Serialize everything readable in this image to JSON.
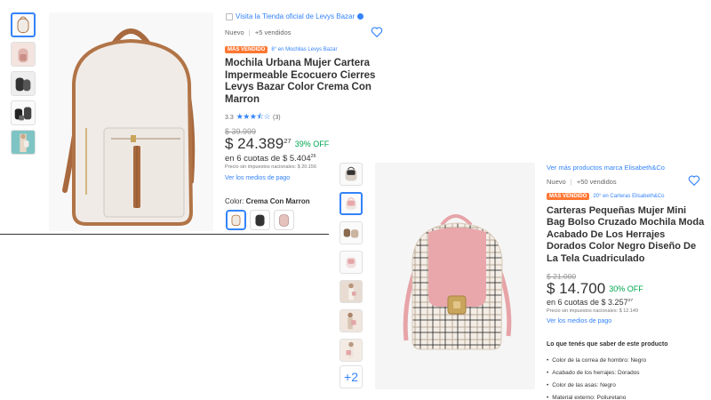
{
  "colors": {
    "accent": "#3483fa",
    "green": "#00a650",
    "badge": "#ff7733"
  },
  "product1": {
    "store_link": "Visita la Tienda oficial de Levys Bazar",
    "condition": "Nuevo",
    "sold": "+5 vendidos",
    "badge": "MÁS VENDIDO",
    "badge_rank": "8° en Mochilas Levys Bazar",
    "title": "Mochila Urbana Mujer Cartera Impermeable Ecocuero Cierres Levys Bazar Color Crema Con Marron",
    "rating": "3.3",
    "stars": 3.3,
    "reviews": "(3)",
    "old_price": "$ 39.999",
    "price": "$ 24.389",
    "price_cents": "27",
    "discount": "39% OFF",
    "installments": "en 6 cuotas de $ 5.404",
    "installments_cents": "26",
    "tax_note": "Precio sin impuestos nacionales: $ 20.156",
    "payment_link": "Ver los medios de pago",
    "color_label": "Color:",
    "color_value": "Crema Con Marron",
    "thumb_icons": [
      "backpack-cream-icon",
      "backpack-pink-icon",
      "backpack-black-icon",
      "backpack-black-set-icon",
      "backpack-model-icon"
    ],
    "swatch_icons": [
      "swatch-cream-icon",
      "swatch-black-icon",
      "swatch-pink-icon"
    ]
  },
  "product2": {
    "brand_link": "Ver más productos marca Elisabeth&Co",
    "condition": "Nuevo",
    "sold": "+50 vendidos",
    "badge": "MÁS VENDIDO",
    "badge_rank": "20° en Carteras Elisabeth&Co",
    "title": "Carteras Pequeñas Mujer Mini Bag Bolso Cruzado Mochila Moda Acabado De Los Herrajes Dorados Color Negro Diseño De La Tela Cuadriculado",
    "old_price": "$ 21.000",
    "price": "$ 14.700",
    "discount": "30% OFF",
    "installments": "en 6 cuotas de $ 3.257",
    "installments_cents": "27",
    "tax_note": "Precio sin impuestos nacionales: $ 12.149",
    "payment_link": "Ver los medios de pago",
    "more_thumbs": "+2",
    "know_title": "Lo que tenés que saber de este producto",
    "specs": [
      "Color de la correa de hombro: Negro",
      "Acabado de los herrajes: Dorados",
      "Color de las asas: Negro",
      "Material externo: Poliuretano"
    ]
  }
}
